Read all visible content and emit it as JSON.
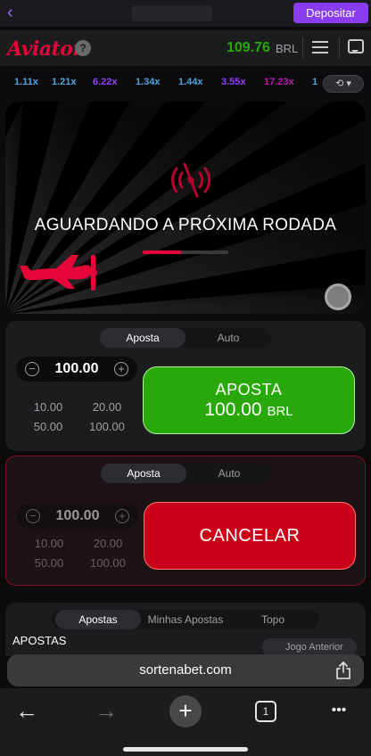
{
  "browser": {
    "back_glyph": "‹",
    "deposit_label": "Depositar"
  },
  "game_header": {
    "logo_text": "Aviator",
    "help_glyph": "?",
    "balance": "109.76",
    "currency": "BRL"
  },
  "multipliers": [
    {
      "value": "1.11x",
      "color": "#4aa3df"
    },
    {
      "value": "1.21x",
      "color": "#4aa3df"
    },
    {
      "value": "6.22x",
      "color": "#913ef8"
    },
    {
      "value": "1.34x",
      "color": "#4aa3df"
    },
    {
      "value": "1.44x",
      "color": "#4aa3df"
    },
    {
      "value": "3.55x",
      "color": "#913ef8"
    },
    {
      "value": "17.23x",
      "color": "#c017b4"
    },
    {
      "value": "1",
      "color": "#4aa3df"
    }
  ],
  "history_button": {
    "icon": "history-icon",
    "glyph": "⟲ ▾"
  },
  "play_area": {
    "status_text": "AGUARDANDO A PRÓXIMA RODADA",
    "progress_fraction": 0.45,
    "accent": "#e50539"
  },
  "bet_panel_1": {
    "tab_bet": "Aposta",
    "tab_auto": "Auto",
    "amount": "100.00",
    "minus_glyph": "−",
    "plus_glyph": "+",
    "quick": [
      "10.00",
      "20.00",
      "50.00",
      "100.00"
    ],
    "button_label": "APOSTA",
    "button_amount": "100.00",
    "button_currency": "BRL"
  },
  "bet_panel_2": {
    "tab_bet": "Aposta",
    "tab_auto": "Auto",
    "amount": "100.00",
    "minus_glyph": "−",
    "plus_glyph": "+",
    "quick": [
      "10.00",
      "20.00",
      "50.00",
      "100.00"
    ],
    "button_label": "CANCELAR"
  },
  "bets_section": {
    "tabs": [
      "Apostas",
      "Minhas Apostas",
      "Topo"
    ],
    "header": "APOSTAS",
    "prev_game": "Jogo Anterior"
  },
  "safari": {
    "url": "sortenabet.com",
    "back_glyph": "←",
    "forward_glyph": "→",
    "new_tab_glyph": "+",
    "tab_count": "1",
    "more_glyph": "•••"
  }
}
